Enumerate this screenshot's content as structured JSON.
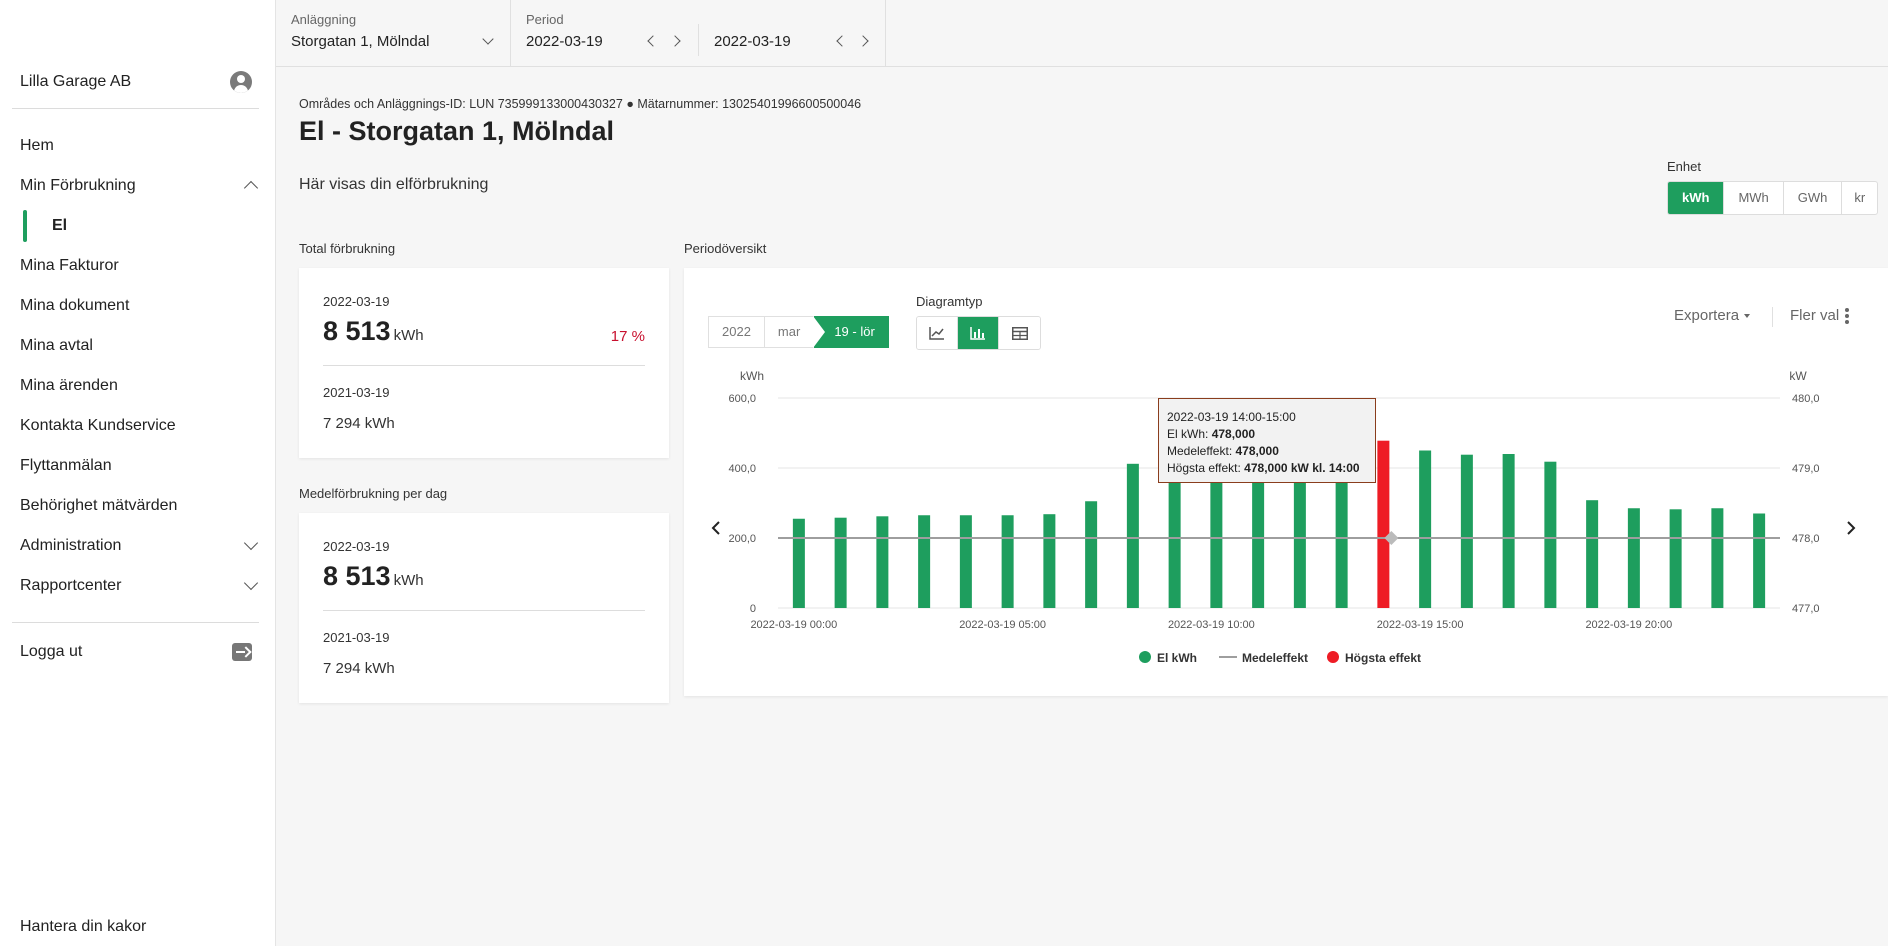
{
  "sidebar": {
    "org_name": "Lilla Garage AB",
    "items": [
      {
        "label": "Hem"
      },
      {
        "label": "Min Förbrukning"
      },
      {
        "label": "El"
      },
      {
        "label": "Mina Fakturor"
      },
      {
        "label": "Mina dokument"
      },
      {
        "label": "Mina avtal"
      },
      {
        "label": "Mina ärenden"
      },
      {
        "label": "Kontakta Kundservice"
      },
      {
        "label": "Flyttanmälan"
      },
      {
        "label": "Behörighet mätvärden"
      },
      {
        "label": "Administration"
      },
      {
        "label": "Rapportcenter"
      }
    ],
    "logout": "Logga ut",
    "cookies": "Hantera din kakor"
  },
  "filters": {
    "facility_label": "Anläggning",
    "facility_value": "Storgatan 1, Mölndal",
    "period_label": "Period",
    "period_from": "2022-03-19",
    "period_to": "2022-03-19"
  },
  "main": {
    "ids": "Områdes och Anläggnings-ID: LUN 735999133000430327 ● Mätarnummer: 13025401996600500046",
    "title": "El - Storgatan 1, Mölndal",
    "intro": "Här visas din elförbrukning",
    "unit_label": "Enhet",
    "units": [
      "kWh",
      "MWh",
      "GWh",
      "kr"
    ],
    "active_unit": "kWh"
  },
  "total": {
    "label": "Total förbrukning",
    "date": "2022-03-19",
    "value": "8 513",
    "unit": "kWh",
    "change": "17 %",
    "prev_date": "2021-03-19",
    "prev_value": "7 294 kWh"
  },
  "average": {
    "label": "Medelförbrukning per dag",
    "date": "2022-03-19",
    "value": "8 513",
    "unit": "kWh",
    "prev_date": "2021-03-19",
    "prev_value": "7 294 kWh"
  },
  "overview": {
    "label": "Periodöversikt",
    "crumbs": [
      "2022",
      "mar",
      "19 - lör"
    ],
    "diagram_label": "Diagramtyp",
    "export": "Exportera",
    "more": "Fler val",
    "tooltip": {
      "time": "2022-03-19 14:00-15:00",
      "el_label": "El kWh:",
      "el_value": "478,000",
      "mean_label": "Medeleffekt:",
      "mean_value": "478,000",
      "peak_label": "Högsta effekt:",
      "peak_value": "478,000 kW kl. 14:00"
    }
  },
  "chart_data": {
    "type": "bar",
    "y_left_unit": "kWh",
    "y_right_unit": "kW",
    "ylim": [
      0,
      600
    ],
    "y2lim": [
      477,
      480
    ],
    "y_ticks": [
      "0",
      "200,0",
      "400,0",
      "600,0"
    ],
    "y2_ticks": [
      "477,0",
      "478,0",
      "479,0",
      "480,0"
    ],
    "x_ticks": [
      {
        "hour": 0,
        "label": "2022-03-19 00:00"
      },
      {
        "hour": 5,
        "label": "2022-03-19 05:00"
      },
      {
        "hour": 10,
        "label": "2022-03-19 10:00"
      },
      {
        "hour": 15,
        "label": "2022-03-19 15:00"
      },
      {
        "hour": 20,
        "label": "2022-03-19 20:00"
      }
    ],
    "series": [
      {
        "name": "El kWh",
        "color": "#1e9e5e",
        "values": [
          255,
          258,
          262,
          265,
          265,
          265,
          268,
          305,
          412,
          415,
          400,
          430,
          430,
          468,
          478,
          450,
          438,
          440,
          418,
          308,
          285,
          282,
          285,
          270
        ]
      },
      {
        "name": "Medeleffekt",
        "color": "#9e9e9e",
        "value": 478.0
      },
      {
        "name": "Högsta effekt",
        "color": "#ee1c25",
        "hour": 14,
        "value": 478.0
      }
    ]
  }
}
